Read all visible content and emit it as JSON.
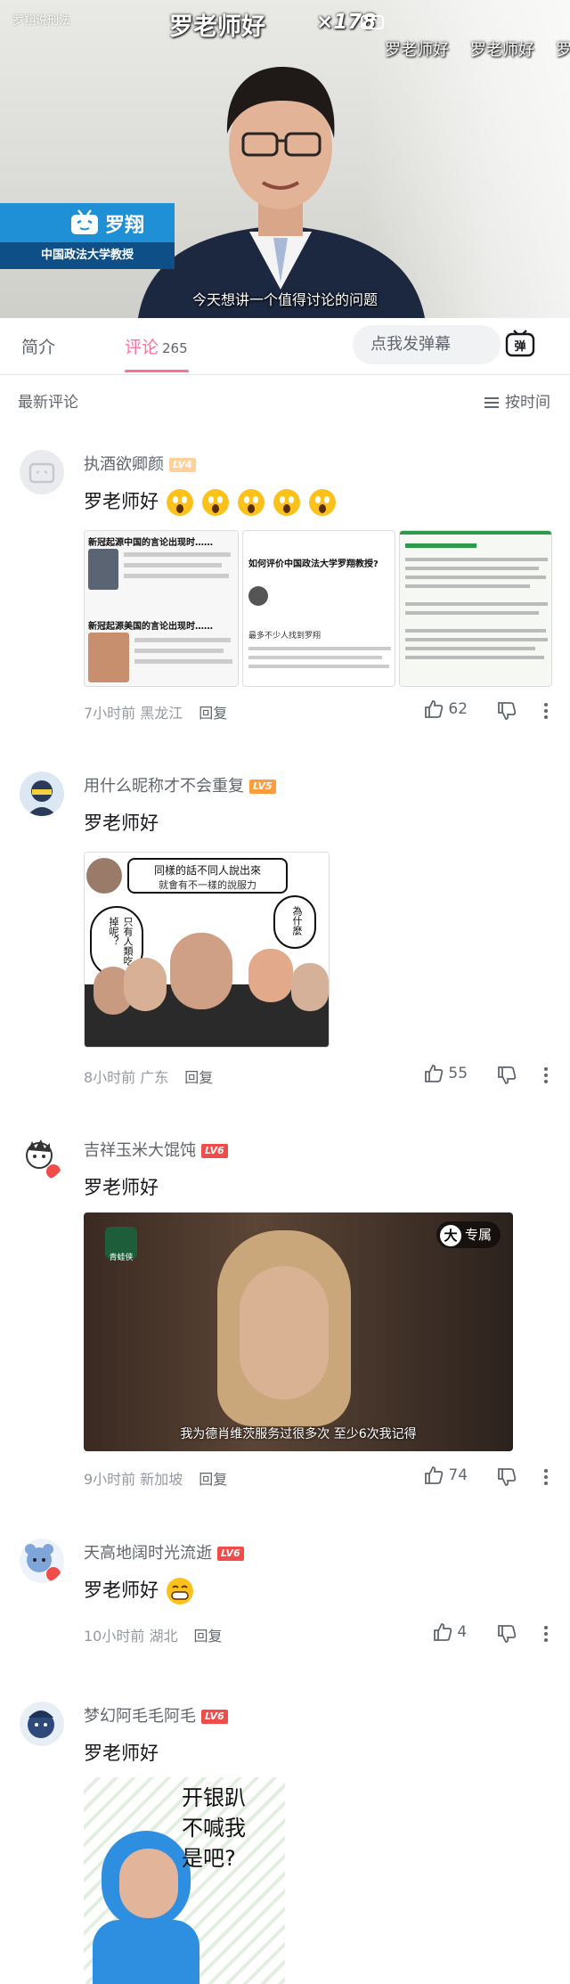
{
  "player": {
    "watermark": "罗翔说刑法",
    "danmaku_main": "罗老师好",
    "danmaku_count": "×178",
    "danmaku_row": [
      "罗老师好",
      "罗老师好",
      "罗"
    ],
    "nameplate_name": "罗翔",
    "nameplate_title": "中国政法大学教授",
    "subtitle": "今天想讲一个值得讨论的问题"
  },
  "tabs": {
    "intro": "简介",
    "comments": "评论",
    "comment_count": "265",
    "danmu_placeholder": "点我发弹幕",
    "danmu_toggle": "弹"
  },
  "sort": {
    "title": "最新评论",
    "button": "按时间"
  },
  "comments": [
    {
      "user": "执酒欲卿颜",
      "level": "LV4",
      "text": "罗老师好",
      "emoji_count": 5,
      "time": "7小时前",
      "location": "黑龙江",
      "reply": "回复",
      "likes": "62",
      "screenshot_texts": [
        "新冠起源中国的言论出现时……",
        "新冠起源美国的言论出现时……",
        "如何评价中国政法大学罗翔教授?",
        "最多不少人找到罗翔"
      ]
    },
    {
      "user": "用什么昵称才不会重复",
      "level": "LV5",
      "text": "罗老师好",
      "time": "8小时前",
      "location": "广东",
      "reply": "回复",
      "likes": "55",
      "meme_texts": [
        "同樣的話不同人說出來",
        "就會有不一樣的說服力",
        "只有人類吃掉呢？",
        "為什麼"
      ]
    },
    {
      "user": "吉祥玉米大馄饨",
      "level": "LV6",
      "text": "罗老师好",
      "time": "9小时前",
      "location": "新加坡",
      "reply": "回复",
      "likes": "74",
      "video_badge": "专属",
      "video_logo": "大",
      "video_channel": "青蛙侠",
      "video_subtitle": "我为德肖维茨服务过很多次 至少6次我记得"
    },
    {
      "user": "天高地阔时光流逝",
      "level": "LV6",
      "text": "罗老师好",
      "time": "10小时前",
      "location": "湖北",
      "reply": "回复",
      "likes": "4"
    },
    {
      "user": "梦幻阿毛毛阿毛",
      "level": "LV6",
      "text": "罗老师好",
      "meme_text": "开银趴\n不喊我\n是吧?"
    }
  ],
  "colors": {
    "accent": "#fb7299",
    "text_secondary": "#61666d",
    "text_muted": "#9499a0",
    "nameplate_blue": "#1f8fd6"
  }
}
